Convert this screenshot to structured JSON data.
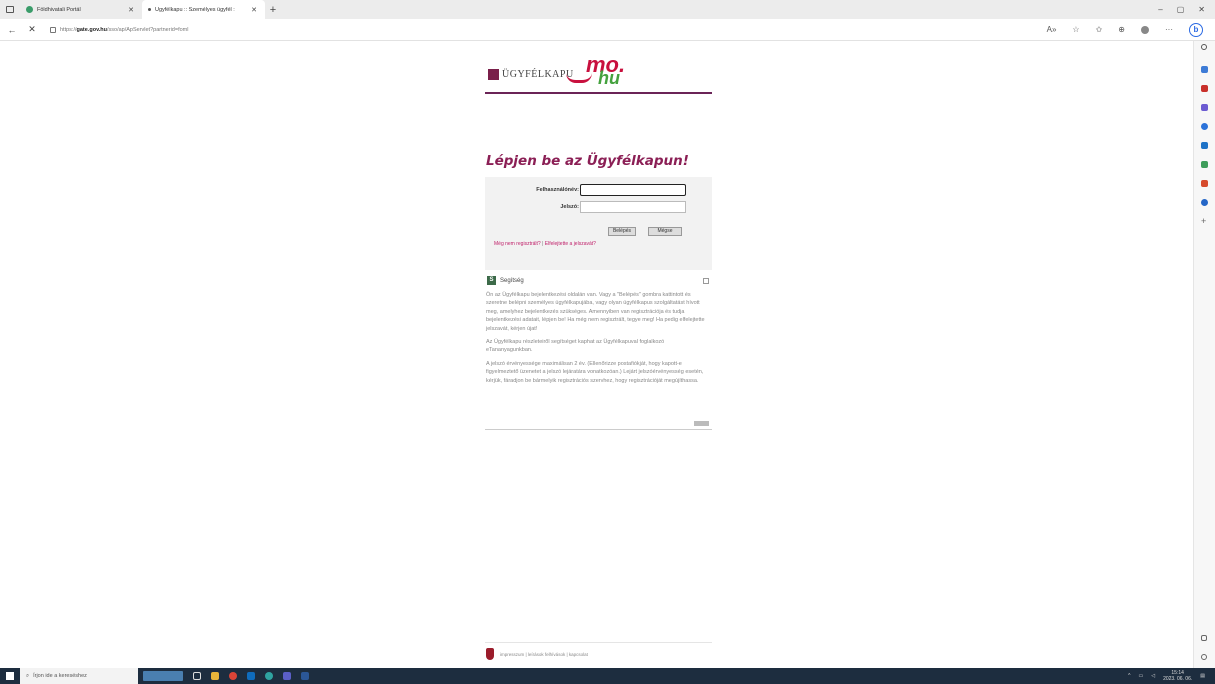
{
  "browser": {
    "tabs": [
      {
        "title": "Földhivatali Portál",
        "active": false
      },
      {
        "title": "Ügyfélkapu :: Személyes ügyfél :",
        "active": true
      }
    ],
    "new_tab": "+",
    "url_prefix": "https://",
    "url_host": "gate.gov.hu",
    "url_path": "/sso/ap/ApServlet?partnerid=foml",
    "window_controls": [
      "–",
      "▢",
      "✕"
    ]
  },
  "logo": {
    "word": "ÜGYFÉLKAPU",
    "mo": "mo.",
    "hu": "hu"
  },
  "login": {
    "heading": "Lépjen be az Ügyfélkapun!",
    "username_label": "Felhasználónév:",
    "password_label": "Jelszó:",
    "login_button": "Belépés",
    "cancel_button": "Mégse",
    "register_link": "Még nem regisztrált?",
    "separator": "|",
    "forgot_link": "Elfelejtette a jelszavát?"
  },
  "help": {
    "icon": "S",
    "title": "Segítség",
    "paragraphs": [
      "Ön az Ügyfélkapu bejelentkezési oldalán van. Vagy a \"Belépés\" gombra kattintott és szeretne belépni személyes ügyfélkapujába, vagy olyan ügyfélkapus szolgáltatást hívott meg, amelyhez bejelentkezés szükséges. Amennyiben van regisztrációja és tudja bejelentkezési adatait, lépjen be! Ha még nem regisztrált, tegye meg! Ha pedig elfelejtette jelszavát, kérjen újat!",
      "Az Ügyfélkapu részleteiről segítséget kaphat az Ügyfélkapuval foglalkozó eTananyagunkban.",
      "A jelszó érvényessége maximálisan 2 év. (Ellenőrizze postafiókját, hogy kapott-e figyelmeztető üzenetet a jelszó lejáratára vonatkozóan.) Lejárt jelszóérvényesség esetén, kérjük, fáradjon be bármelyik regisztrációs szervhez, hogy regisztrációját megújíthassa."
    ]
  },
  "footer": {
    "text": "impresszum | leírások felhívások | kapcsolat"
  },
  "taskbar": {
    "search_placeholder": "Írjon ide a kereséshez",
    "time": "15:14",
    "date": "2023. 06. 06."
  }
}
